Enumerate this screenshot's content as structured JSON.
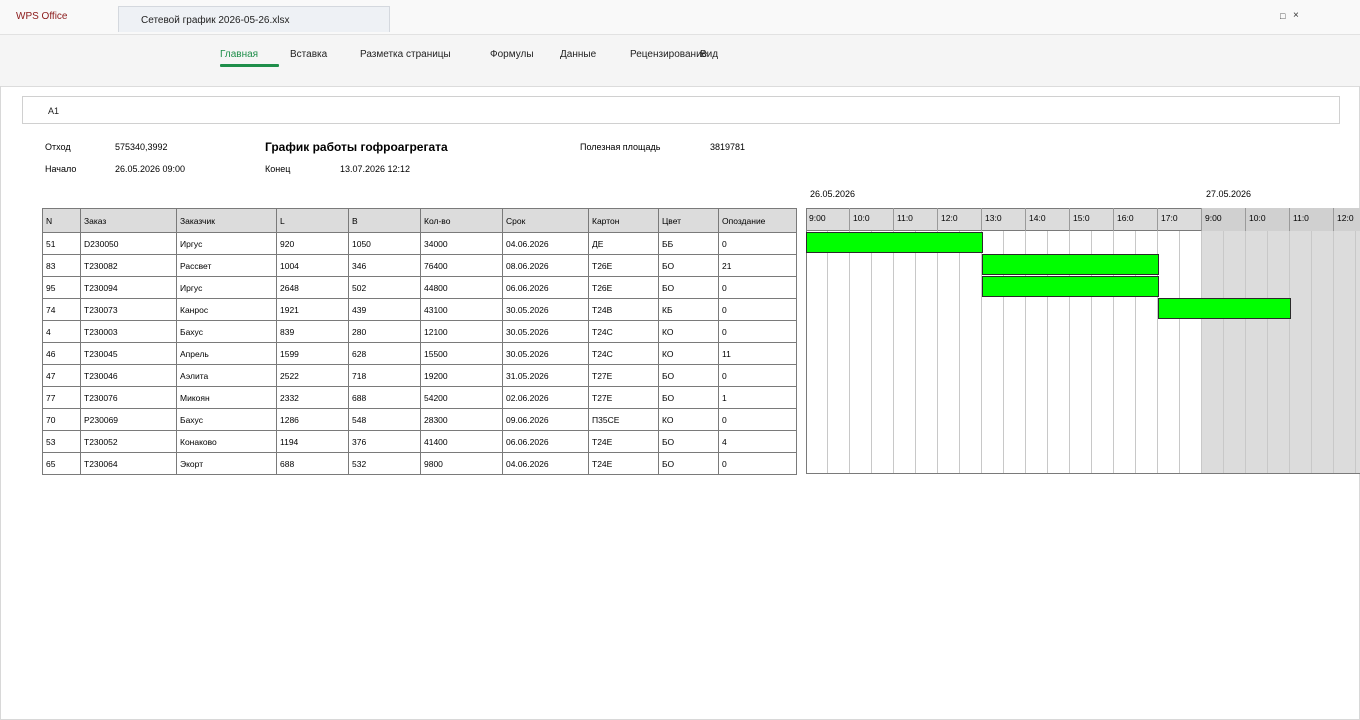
{
  "app": {
    "name": "WPS Office",
    "tab_title": "Сетевой график 2026-05-26.xlsx",
    "restore_label": "□",
    "close_label": "×"
  },
  "ribbon": {
    "tabs": [
      "Главная",
      "Вставка",
      "Разметка страницы",
      "Формулы",
      "Данные",
      "Рецензирование",
      "Вид"
    ],
    "active": "Главная",
    "accent": "#1f8e4a"
  },
  "cell_ref": "A1",
  "info": {
    "otkhod_label": "Отход",
    "otkhod_value": "575340,3992",
    "nachalo_label": "Начало",
    "nachalo_value": "26.05.2026 09:00",
    "title": "График работы гофроагрегата",
    "konets_label": "Конец",
    "konets_value": "13.07.2026 12:12",
    "area_label": "Полезная площадь",
    "area_value": "3819781"
  },
  "table": {
    "headers": [
      "N",
      "Заказ",
      "Заказчик",
      "L",
      "B",
      "Кол-во",
      "Срок",
      "Картон",
      "Цвет",
      "Опоздание"
    ],
    "rows": [
      [
        "51",
        "D230050",
        "Иргус",
        "920",
        "1050",
        "34000",
        "04.06.2026",
        "ДЕ",
        "ББ",
        "0"
      ],
      [
        "83",
        "T230082",
        "Рассвет",
        "1004",
        "346",
        "76400",
        "08.06.2026",
        "Т26Е",
        "БО",
        "21"
      ],
      [
        "95",
        "T230094",
        "Иргус",
        "2648",
        "502",
        "44800",
        "06.06.2026",
        "Т26Е",
        "БО",
        "0"
      ],
      [
        "74",
        "T230073",
        "Канрос",
        "1921",
        "439",
        "43100",
        "30.05.2026",
        "Т24В",
        "КБ",
        "0"
      ],
      [
        "4",
        "T230003",
        "Бахус",
        "839",
        "280",
        "12100",
        "30.05.2026",
        "Т24С",
        "КО",
        "0"
      ],
      [
        "46",
        "T230045",
        "Апрель",
        "1599",
        "628",
        "15500",
        "30.05.2026",
        "Т24С",
        "КО",
        "11"
      ],
      [
        "47",
        "T230046",
        "Аэлита",
        "2522",
        "718",
        "19200",
        "31.05.2026",
        "Т27Е",
        "БО",
        "0"
      ],
      [
        "77",
        "T230076",
        "Микоян",
        "2332",
        "688",
        "54200",
        "02.06.2026",
        "Т27Е",
        "БО",
        "1"
      ],
      [
        "70",
        "P230069",
        "Бахус",
        "1286",
        "548",
        "28300",
        "09.06.2026",
        "П35СЕ",
        "КО",
        "0"
      ],
      [
        "53",
        "T230052",
        "Конаково",
        "1194",
        "376",
        "41400",
        "06.06.2026",
        "Т24Е",
        "БО",
        "4"
      ],
      [
        "65",
        "T230064",
        "Экорт",
        "688",
        "532",
        "9800",
        "04.06.2026",
        "Т24Е",
        "БО",
        "0"
      ]
    ]
  },
  "gantt": {
    "dates": [
      "26.05.2026",
      "27.05.2026"
    ],
    "hours": [
      "9:00",
      "10:0",
      "11:0",
      "12:0",
      "13:0",
      "14:0",
      "15:0",
      "16:0",
      "17:0",
      "9:00",
      "10:0",
      "11:0",
      "12:0"
    ],
    "bar_color": "#00ff00",
    "off_color": "#dcdcdc",
    "bars": [
      {
        "row": 0,
        "start": 0,
        "end": 4
      },
      {
        "row": 1,
        "start": 4,
        "end": 8
      },
      {
        "row": 2,
        "start": 4,
        "end": 8
      },
      {
        "row": 3,
        "start": 8,
        "end": 11
      }
    ]
  }
}
